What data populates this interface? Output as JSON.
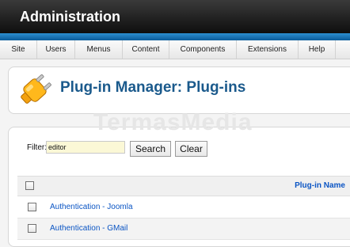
{
  "app": {
    "title": "Administration"
  },
  "menu": [
    "Site",
    "Users",
    "Menus",
    "Content",
    "Components",
    "Extensions",
    "Help"
  ],
  "page": {
    "title": "Plug-in Manager: Plug-ins",
    "icon": "plugin-icon"
  },
  "watermark": "TermasMedia",
  "filter": {
    "label": "Filter:",
    "value": "editor",
    "search_label": "Search",
    "clear_label": "Clear"
  },
  "table": {
    "column_header": "Plug-in Name",
    "rows": [
      {
        "name": "Authentication - Joomla"
      },
      {
        "name": "Authentication - GMail"
      }
    ]
  },
  "colors": {
    "accent_blue": "#1b5a8c",
    "link_blue": "#0b55c4",
    "topbar_blue": "#2b8fd0"
  }
}
